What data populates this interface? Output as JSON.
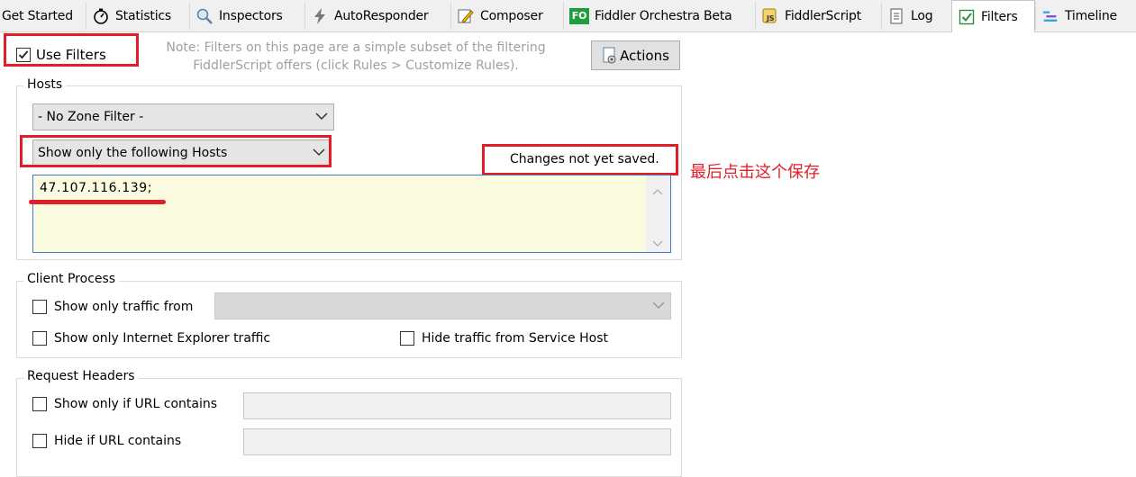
{
  "tabs": [
    {
      "label": "Get Started",
      "icon": "none"
    },
    {
      "label": "Statistics",
      "icon": "stopwatch-icon"
    },
    {
      "label": "Inspectors",
      "icon": "magnifier-icon"
    },
    {
      "label": "AutoResponder",
      "icon": "lightning-icon"
    },
    {
      "label": "Composer",
      "icon": "pencil-icon"
    },
    {
      "label": "Fiddler Orchestra Beta",
      "icon": "fo-icon",
      "icon_text": "FO"
    },
    {
      "label": "FiddlerScript",
      "icon": "script-icon",
      "icon_text": "JS"
    },
    {
      "label": "Log",
      "icon": "document-icon"
    },
    {
      "label": "Filters",
      "icon": "checkbox-icon"
    },
    {
      "label": "Timeline",
      "icon": "timeline-icon"
    }
  ],
  "use_filters": {
    "label": "Use Filters",
    "checked": true
  },
  "note": {
    "line1": "Note: Filters on this page are a simple subset of the filtering",
    "line2": "FiddlerScript offers (click Rules > Customize Rules)."
  },
  "actions_button": "Actions",
  "hosts": {
    "title": "Hosts",
    "zone_filter": "- No Zone Filter -",
    "host_filter": "Show only the following Hosts",
    "hosts_value": "47.107.116.139;",
    "status": "Changes not yet saved."
  },
  "annotation": {
    "text": "最后点击这个保存"
  },
  "client_process": {
    "title": "Client Process",
    "show_only_traffic_from": "Show only traffic from",
    "show_only_ie": "Show only Internet Explorer traffic",
    "hide_service_host": "Hide traffic from Service Host"
  },
  "request_headers": {
    "title": "Request Headers",
    "show_if_url": "Show only if URL contains",
    "hide_if_url": "Hide if URL contains"
  },
  "colors": {
    "highlight_red": "#e01e28",
    "hosts_textarea_bg": "#fbfbe0",
    "textarea_border": "#3c7fd1"
  }
}
